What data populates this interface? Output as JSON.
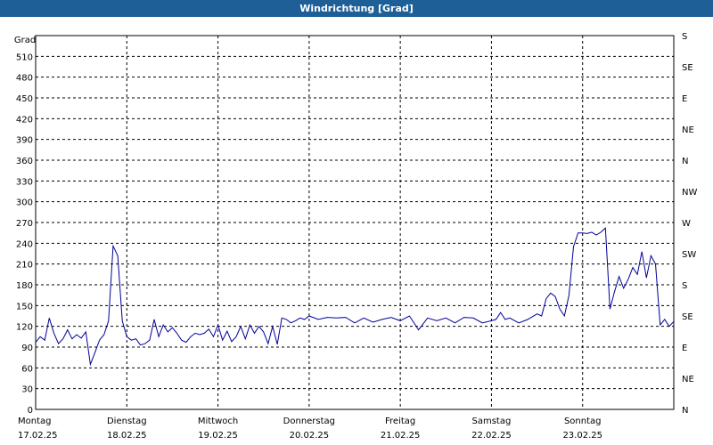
{
  "window": {
    "title": "Windrichtung [Grad]"
  },
  "chart_data": {
    "type": "line",
    "title": "Windrichtung [Grad]",
    "ylabel": "Grad",
    "ylim": [
      0,
      540
    ],
    "y_ticks": [
      0,
      30,
      60,
      90,
      120,
      150,
      180,
      210,
      240,
      270,
      300,
      330,
      360,
      390,
      420,
      450,
      480,
      510
    ],
    "right_ticks": [
      {
        "value": 0,
        "label": "N"
      },
      {
        "value": 45,
        "label": "NE"
      },
      {
        "value": 90,
        "label": "E"
      },
      {
        "value": 135,
        "label": "SE"
      },
      {
        "value": 180,
        "label": "S"
      },
      {
        "value": 225,
        "label": "SW"
      },
      {
        "value": 270,
        "label": "W"
      },
      {
        "value": 315,
        "label": "NW"
      },
      {
        "value": 360,
        "label": "N"
      },
      {
        "value": 405,
        "label": "NE"
      },
      {
        "value": 450,
        "label": "E"
      },
      {
        "value": 495,
        "label": "SE"
      },
      {
        "value": 540,
        "label": "S"
      }
    ],
    "xlim": [
      0,
      7
    ],
    "x_ticks": [
      {
        "day": "Montag",
        "date": "17.02.25"
      },
      {
        "day": "Dienstag",
        "date": "18.02.25"
      },
      {
        "day": "Mittwoch",
        "date": "19.02.25"
      },
      {
        "day": "Donnerstag",
        "date": "20.02.25"
      },
      {
        "day": "Freitag",
        "date": "21.02.25"
      },
      {
        "day": "Samstag",
        "date": "22.02.25"
      },
      {
        "day": "Sonntag",
        "date": "23.02.25"
      }
    ],
    "grid": true,
    "line_color": "#000099",
    "series": [
      {
        "x": [
          0.0,
          0.05,
          0.1,
          0.15,
          0.2,
          0.25,
          0.3,
          0.35,
          0.4,
          0.45,
          0.5,
          0.55,
          0.6,
          0.65,
          0.7,
          0.75,
          0.8,
          0.85,
          0.9,
          0.95,
          1.0,
          1.05,
          1.1,
          1.15,
          1.2,
          1.25,
          1.3,
          1.35,
          1.4,
          1.45,
          1.5,
          1.55,
          1.6,
          1.65,
          1.7,
          1.75,
          1.8,
          1.85,
          1.9,
          1.95,
          2.0,
          2.05,
          2.1,
          2.15,
          2.2,
          2.25,
          2.3,
          2.35,
          2.4,
          2.45,
          2.5,
          2.55,
          2.6,
          2.65,
          2.7,
          2.75,
          2.8,
          2.85,
          2.9,
          2.95,
          3.0,
          3.1,
          3.2,
          3.3,
          3.4,
          3.5,
          3.6,
          3.7,
          3.8,
          3.9,
          4.0,
          4.1,
          4.2,
          4.3,
          4.4,
          4.5,
          4.6,
          4.7,
          4.8,
          4.9,
          5.0,
          5.05,
          5.1,
          5.15,
          5.2,
          5.3,
          5.4,
          5.5,
          5.55,
          5.6,
          5.65,
          5.7,
          5.75,
          5.8,
          5.85,
          5.9,
          5.95,
          6.0,
          6.05,
          6.1,
          6.15,
          6.2,
          6.25,
          6.3,
          6.35,
          6.4,
          6.45,
          6.5,
          6.55,
          6.6,
          6.65,
          6.7,
          6.75,
          6.8,
          6.85,
          6.9,
          6.95,
          7.0
        ],
        "y": [
          97,
          105,
          100,
          132,
          110,
          95,
          102,
          115,
          102,
          108,
          103,
          112,
          65,
          82,
          100,
          108,
          128,
          236,
          222,
          128,
          105,
          100,
          102,
          93,
          95,
          100,
          130,
          105,
          122,
          112,
          118,
          110,
          100,
          97,
          105,
          110,
          108,
          110,
          116,
          105,
          122,
          100,
          113,
          98,
          105,
          120,
          102,
          122,
          110,
          120,
          112,
          95,
          120,
          94,
          132,
          130,
          125,
          128,
          132,
          130,
          135,
          130,
          133,
          132,
          133,
          125,
          132,
          126,
          130,
          133,
          128,
          135,
          115,
          132,
          128,
          132,
          125,
          133,
          132,
          125,
          128,
          130,
          140,
          130,
          132,
          125,
          130,
          138,
          135,
          160,
          168,
          163,
          145,
          135,
          165,
          235,
          255,
          255,
          254,
          256,
          252,
          256,
          262,
          145,
          170,
          192,
          175,
          188,
          205,
          195,
          228,
          190,
          222,
          210,
          122,
          130,
          120,
          127
        ]
      }
    ]
  }
}
